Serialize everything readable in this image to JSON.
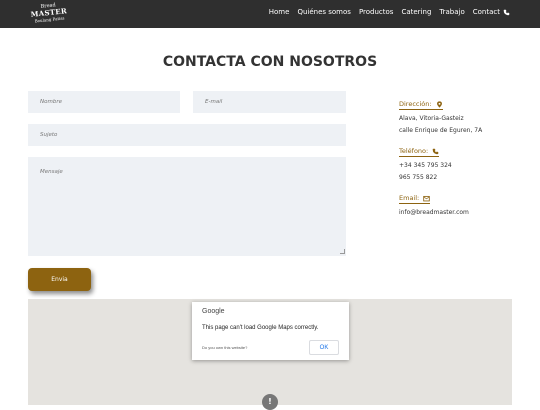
{
  "nav": {
    "logo": {
      "line1": "Bread",
      "line2": "MASTER",
      "line3": "Boulang Patiss"
    },
    "items": [
      {
        "label": "Home"
      },
      {
        "label": "Quiénes somos"
      },
      {
        "label": "Productos"
      },
      {
        "label": "Catering"
      },
      {
        "label": "Trabajo"
      },
      {
        "label": "Contact",
        "icon": "phone-icon"
      }
    ]
  },
  "page": {
    "title": "CONTACTA CON NOSOTROS"
  },
  "form": {
    "name_placeholder": "Nombre",
    "email_placeholder": "E-mail",
    "subject_placeholder": "Sujeto",
    "message_placeholder": "Mensaje",
    "send_label": "Envia"
  },
  "contact": {
    "address_title": "Dirección:",
    "address_lines": [
      "Alava, Vitoria-Gasteiz",
      "calle Enrique de Eguren, 7A"
    ],
    "phone_title": "Teléfono:",
    "phone_lines": [
      "+34 345 795 324",
      "965 755 822"
    ],
    "email_title": "Email:",
    "email_lines": [
      "info@breadmaster.com"
    ]
  },
  "map": {
    "brand": "Google",
    "message": "This page can't load Google Maps correctly.",
    "own_question": "Do you own this website?",
    "ok_label": "OK",
    "pin_label": "!"
  },
  "colors": {
    "nav_bg": "#2f2f2f",
    "accent": "#8d6310",
    "field_bg": "#eef1f5",
    "map_bg": "#e5e3df"
  }
}
